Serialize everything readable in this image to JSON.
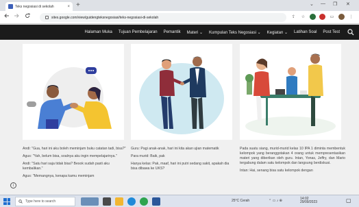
{
  "browser": {
    "tab_title": "Teks negosiasi di sekolah",
    "tab_close": "×",
    "new_tab": "+",
    "window_controls": [
      "⌄",
      "—",
      "❐",
      "✕"
    ],
    "url": "sites.google.com/view/guidengteksnegosiasi/teks-negosiasi-di-sekolah"
  },
  "site_nav": {
    "items": [
      "Halaman Muka",
      "Tujuan Pembelajaran",
      "Pemantik",
      "Materi ⌄",
      "Kumpulan Teks Negosiasi ⌄",
      "Kegiatan ⌄",
      "Latihan Soal",
      "Post Test"
    ]
  },
  "column1": [
    "Andi: \"Gua, hari ini aku boleh meminjam buku catatan tadi, bisa?\"",
    "Agus: \"Yah, belum bisa, soalnya aku ingin mempelajarinya.\"",
    "Andi: \"Satu hari saja tidak bisa? Besok sudah pasti aku kembalikan.\"",
    "Agus: \"Memangnya, kenapa kamu meminjam"
  ],
  "column2": [
    "Guru: Pagi anak-anak, hari ini kita akan ujian matematik",
    "Para murid: Baik, pak",
    "Hanya kelas: Pak, maaf, hari ini putri sedang sakit, apakah dia bisa dibawa ke UKS?"
  ],
  "column3": [
    "Pada suatu siang, murid-murid kelas 10 IPA 1 diminta membentuk kelompok yang beranggotakan 4 orang untuk mempresentasikan materi yang diberikan oleh guru. Intan, Yonas, Jeffry, dan Mario tergabung dalam satu kelompok dan langsung berdiskusi.",
    "Intan: Hai, senang bisa satu kelompok dengan"
  ],
  "taskbar": {
    "search_placeholder": "Type here to search",
    "weather": "25°C Cerah",
    "time": "14:02",
    "date": "29/09/2023"
  },
  "colors": {
    "nav_bg": "#1b1b1b",
    "card_bg": "#ffffff",
    "page_bg": "#f0f0f0"
  }
}
